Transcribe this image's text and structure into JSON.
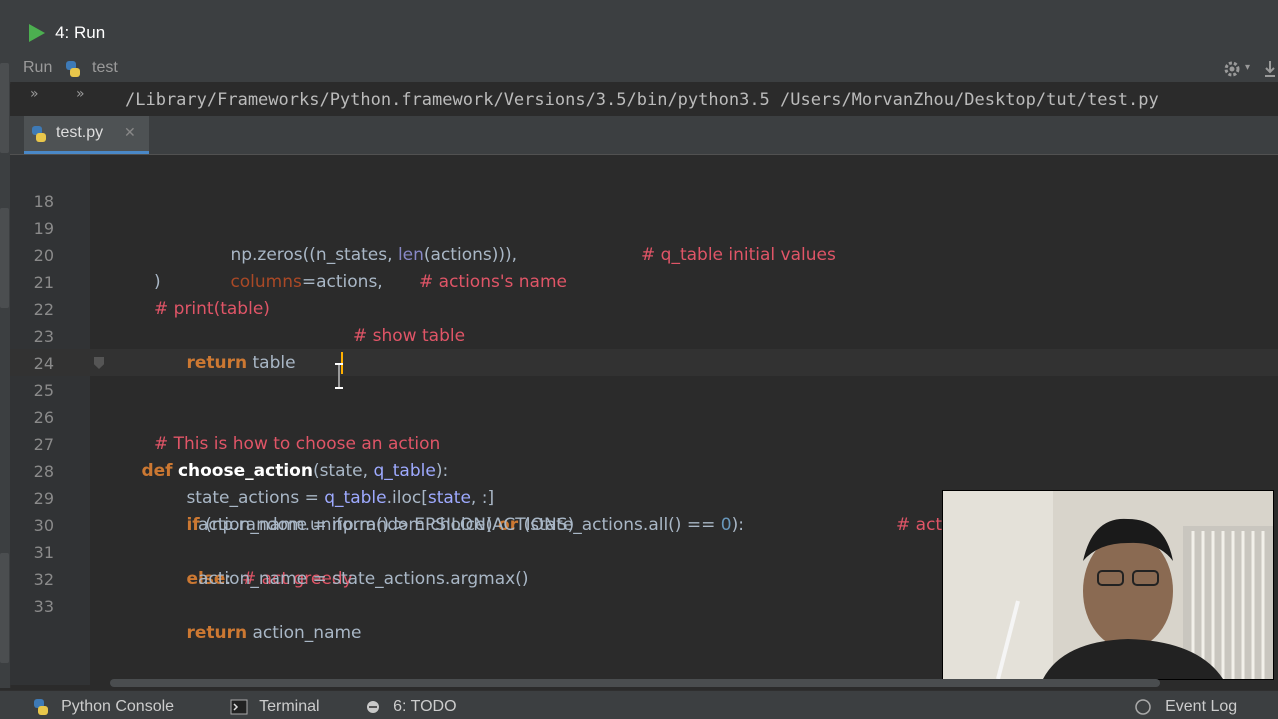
{
  "run_header": {
    "title": "4: Run"
  },
  "run_toolbar": {
    "run_label": "Run",
    "config_name": "test"
  },
  "run_output": {
    "command": "/Library/Frameworks/Python.framework/Versions/3.5/bin/python3.5 /Users/MorvanZhou/Desktop/tut/test.py"
  },
  "editor_tab": {
    "filename": "test.py"
  },
  "code_lines": [
    {
      "num": "18"
    },
    {
      "num": "19"
    },
    {
      "num": "20"
    },
    {
      "num": "21"
    },
    {
      "num": "22"
    },
    {
      "num": "23"
    },
    {
      "num": "24"
    },
    {
      "num": "25"
    },
    {
      "num": "26"
    },
    {
      "num": "27"
    },
    {
      "num": "28"
    },
    {
      "num": "29"
    },
    {
      "num": "30"
    },
    {
      "num": "31"
    },
    {
      "num": "32"
    },
    {
      "num": "33"
    }
  ],
  "code_tokens": {
    "l18_a": "np.zeros((n_states, ",
    "l18_b": "len",
    "l18_c": "(actions))),",
    "l18_cm": "# q_table initial values",
    "l19_kw": "columns",
    "l19_b": "=actions,",
    "l19_cm": "# actions's name",
    "l20": ")",
    "l21_cm1": "# print(table)",
    "l21_cm2": "# show table",
    "l22_kw": "return",
    "l22_b": " table",
    "l25_kw": "def",
    "l25_fn": "choose_action",
    "l25_a": "(",
    "l25_p1": "state",
    "l25_b": ", ",
    "l25_p2": "q_table",
    "l25_c": "):",
    "l26_cm": "# This is how to choose an action",
    "l27_a": "state_actions = ",
    "l27_b": "q_table",
    "l27_c": ".iloc[",
    "l27_d": "state",
    "l27_e": ", :]",
    "l28_kw1": "if",
    "l28_a": " (np.random.uniform() > EPSILON) ",
    "l28_kw2": "or",
    "l28_b": " (state_actions.all() == ",
    "l28_n": "0",
    "l28_c": "):",
    "l28_cm": "# act non-greedy or state-action ha",
    "l29": "action_name = np.random.choice(ACTIONS)",
    "l30_kw": "else",
    "l30_a": ":",
    "l30_cm": "# act greedy",
    "l31": "action_name = state_actions.argmax()",
    "l32_kw": "return",
    "l32_b": " action_name"
  },
  "bottom_tabs": {
    "python_console": "Python Console",
    "terminal": "Terminal",
    "todo": "6: TODO",
    "event_log": "Event Log"
  },
  "colors": {
    "keyword": "#cc7832",
    "comment": "#e05567",
    "number": "#6897bb",
    "run_green": "#4caf50"
  }
}
